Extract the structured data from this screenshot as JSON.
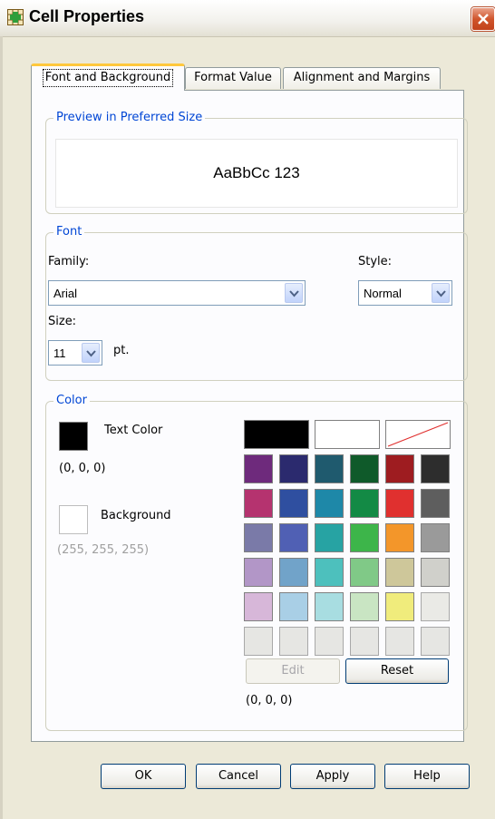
{
  "window": {
    "title": "Cell Properties"
  },
  "tabs": [
    {
      "label": "Font and Background",
      "active": true
    },
    {
      "label": "Format Value",
      "active": false
    },
    {
      "label": "Alignment and Margins",
      "active": false
    }
  ],
  "preview": {
    "group_title": "Preview in Preferred Size",
    "sample_text": "AaBbCc 123"
  },
  "font": {
    "group_title": "Font",
    "family_label": "Family:",
    "family_value": "Arial",
    "style_label": "Style:",
    "style_value": "Normal",
    "size_label": "Size:",
    "size_value": "11",
    "size_unit": "pt."
  },
  "color": {
    "group_title": "Color",
    "text_color_label": "Text Color",
    "text_color_value": "(0, 0, 0)",
    "text_color_hex": "#000000",
    "background_label": "Background",
    "background_value": "(255, 255, 255)",
    "background_hex": "#ffffff",
    "palette_top": [
      "#000000",
      "#ffffff",
      "none"
    ],
    "palette_rows": [
      [
        "#6e2a7c",
        "#2b2a6e",
        "#1f5a6e",
        "#0f5a2a",
        "#9e1c20",
        "#2d2d2d"
      ],
      [
        "#b5336f",
        "#2f4fa0",
        "#1e88a8",
        "#138a45",
        "#e0302f",
        "#5e5e5e"
      ],
      [
        "#7a7aa8",
        "#5060b4",
        "#27a3a3",
        "#3db54a",
        "#f3962a",
        "#9a9a9a"
      ],
      [
        "#b296c7",
        "#71a3c9",
        "#4dc0bd",
        "#80c987",
        "#cec79a",
        "#d0d0cb"
      ],
      [
        "#d7b7d9",
        "#a9cfe6",
        "#a8dde1",
        "#c9e5c3",
        "#f0ec7c",
        "#eaeae6"
      ],
      [
        "#e6e6e3",
        "#e6e6e3",
        "#e6e6e3",
        "#e6e6e3",
        "#e6e6e3",
        "#e6e6e3"
      ]
    ],
    "edit_label": "Edit",
    "reset_label": "Reset",
    "selected_value": "(0, 0, 0)"
  },
  "buttons": {
    "ok": "OK",
    "cancel": "Cancel",
    "apply": "Apply",
    "help": "Help"
  },
  "icons": {
    "app": "cell-properties-icon",
    "close": "close-icon",
    "dropdown": "chevron-down-icon"
  }
}
